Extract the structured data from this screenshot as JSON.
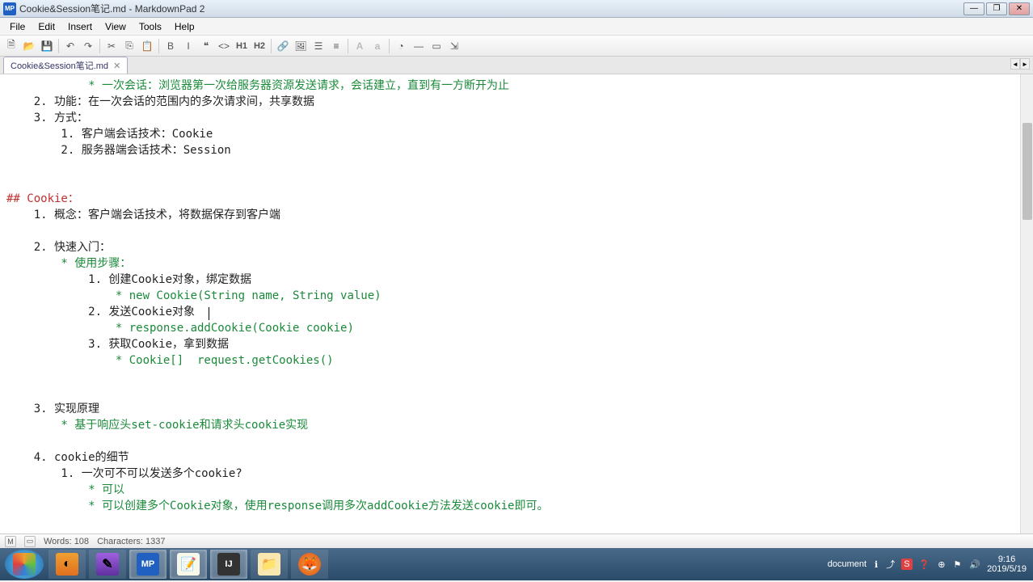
{
  "window": {
    "title": "Cookie&Session笔记.md - MarkdownPad 2",
    "app_icon": "MP"
  },
  "menu": [
    "File",
    "Edit",
    "Insert",
    "View",
    "Tools",
    "Help"
  ],
  "toolbar_icons": [
    {
      "name": "new-file-icon",
      "glyph": "🗎"
    },
    {
      "name": "open-file-icon",
      "glyph": "📂"
    },
    {
      "name": "save-icon",
      "glyph": "💾"
    },
    {
      "sep": true
    },
    {
      "name": "undo-icon",
      "glyph": "↶"
    },
    {
      "name": "redo-icon",
      "glyph": "↷"
    },
    {
      "sep": true
    },
    {
      "name": "cut-icon",
      "glyph": "✂"
    },
    {
      "name": "copy-icon",
      "glyph": "⎘"
    },
    {
      "name": "paste-icon",
      "glyph": "📋"
    },
    {
      "sep": true
    },
    {
      "name": "bold-icon",
      "glyph": "B"
    },
    {
      "name": "italic-icon",
      "glyph": "I"
    },
    {
      "name": "quote-icon",
      "glyph": "❝"
    },
    {
      "name": "code-icon",
      "glyph": "<>"
    },
    {
      "name": "h1-icon",
      "glyph": "H1"
    },
    {
      "name": "h2-icon",
      "glyph": "H2"
    },
    {
      "sep": true
    },
    {
      "name": "link-icon",
      "glyph": "🔗"
    },
    {
      "name": "image-icon",
      "glyph": "🖼"
    },
    {
      "name": "ul-icon",
      "glyph": "☰"
    },
    {
      "name": "ol-icon",
      "glyph": "≡"
    },
    {
      "sep": true
    },
    {
      "name": "font-up-icon",
      "glyph": "A"
    },
    {
      "name": "font-down-icon",
      "glyph": "a"
    },
    {
      "sep": true
    },
    {
      "name": "timestamp-icon",
      "glyph": "◔"
    },
    {
      "name": "hr-icon",
      "glyph": "—"
    },
    {
      "name": "preview-icon",
      "glyph": "▭"
    },
    {
      "name": "browser-icon",
      "glyph": "⇲"
    }
  ],
  "tab": {
    "label": "Cookie&Session笔记.md"
  },
  "content": {
    "l1a": "            * ",
    "l1b": "一次会话：浏览器第一次给服务器资源发送请求，会话建立，直到有一方断开为止",
    "l2": "    2. 功能：在一次会话的范围内的多次请求间，共享数据",
    "l3": "    3. 方式：",
    "l4": "        1. 客户端会话技术：Cookie",
    "l5": "        2. 服务器端会话技术：Session",
    "l6": "",
    "l7": "",
    "l8": "## Cookie：",
    "l9": "    1. 概念：客户端会话技术，将数据保存到客户端",
    "l10": "",
    "l11": "    2. 快速入门：",
    "l12a": "        * ",
    "l12b": "使用步骤：",
    "l13": "            1. 创建Cookie对象，绑定数据",
    "l14a": "                * ",
    "l14b": "new Cookie(String name, String value)",
    "l15": "            2. 发送Cookie对象",
    "l16a": "                * ",
    "l16b": "response.addCookie(Cookie cookie)",
    "l17": "            3. 获取Cookie，拿到数据",
    "l18a": "                * ",
    "l18b": "Cookie[]  request.getCookies()",
    "l19": "",
    "l20": "",
    "l21": "    3. 实现原理",
    "l22a": "        * ",
    "l22b": "基于响应头set-cookie和请求头cookie实现",
    "l23": "",
    "l24": "    4. cookie的细节",
    "l25": "        1. 一次可不可以发送多个cookie?",
    "l26a": "            * ",
    "l26b": "可以",
    "l27a": "            * ",
    "l27b": "可以创建多个Cookie对象，使用response调用多次addCookie方法发送cookie即可。"
  },
  "status": {
    "words_label": "Words: 108",
    "chars_label": "Characters: 1337"
  },
  "tray": {
    "doc": "document",
    "time": "9:16",
    "date": "2019/5/19"
  }
}
